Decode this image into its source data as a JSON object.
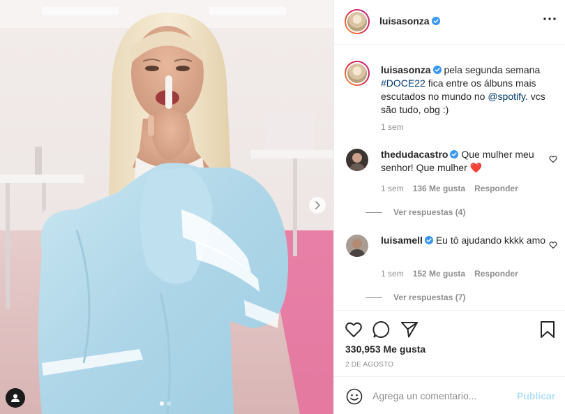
{
  "post": {
    "username": "luisasonza",
    "caption": {
      "text_before": "pela segunda semana",
      "hashtag": "#DOCE22",
      "text_middle": "fica entre os álbuns mais escutados no mundo no",
      "mention": "@spotify",
      "text_after": ". vcs são tudo, obg :)",
      "time": "1 sem"
    },
    "comments": [
      {
        "username": "thedudacastro",
        "text": "Que mulher meu senhor! Que mulher",
        "emoji": "❤️",
        "time": "1 sem",
        "likes": "136 Me gusta",
        "reply_label": "Responder",
        "view_replies": "Ver respuestas (4)"
      },
      {
        "username": "luisamell",
        "text": "Eu tô ajudando kkkk amo",
        "time": "1 sem",
        "likes": "152 Me gusta",
        "reply_label": "Responder",
        "view_replies": "Ver respuestas (7)"
      }
    ],
    "likes_label": "330,953 Me gusta",
    "date": "2 DE AGOSTO",
    "carousel": {
      "current": 1,
      "total": 2
    }
  },
  "composer": {
    "placeholder": "Agrega un comentario...",
    "publish_label": "Publicar"
  },
  "icons": {
    "verified": "verified-badge-icon",
    "more": "more-options-icon",
    "like": "heart-icon",
    "comment": "comment-icon",
    "share": "paper-plane-icon",
    "save": "bookmark-icon",
    "emoji": "emoji-icon",
    "next": "chevron-right-icon",
    "tag": "user-tag-icon"
  },
  "colors": {
    "verified_blue": "#3897f0",
    "link": "#00376b",
    "muted_text": "#8e8e8e",
    "publish_disabled": "#b2dffc",
    "heart_red": "#e0245e"
  }
}
